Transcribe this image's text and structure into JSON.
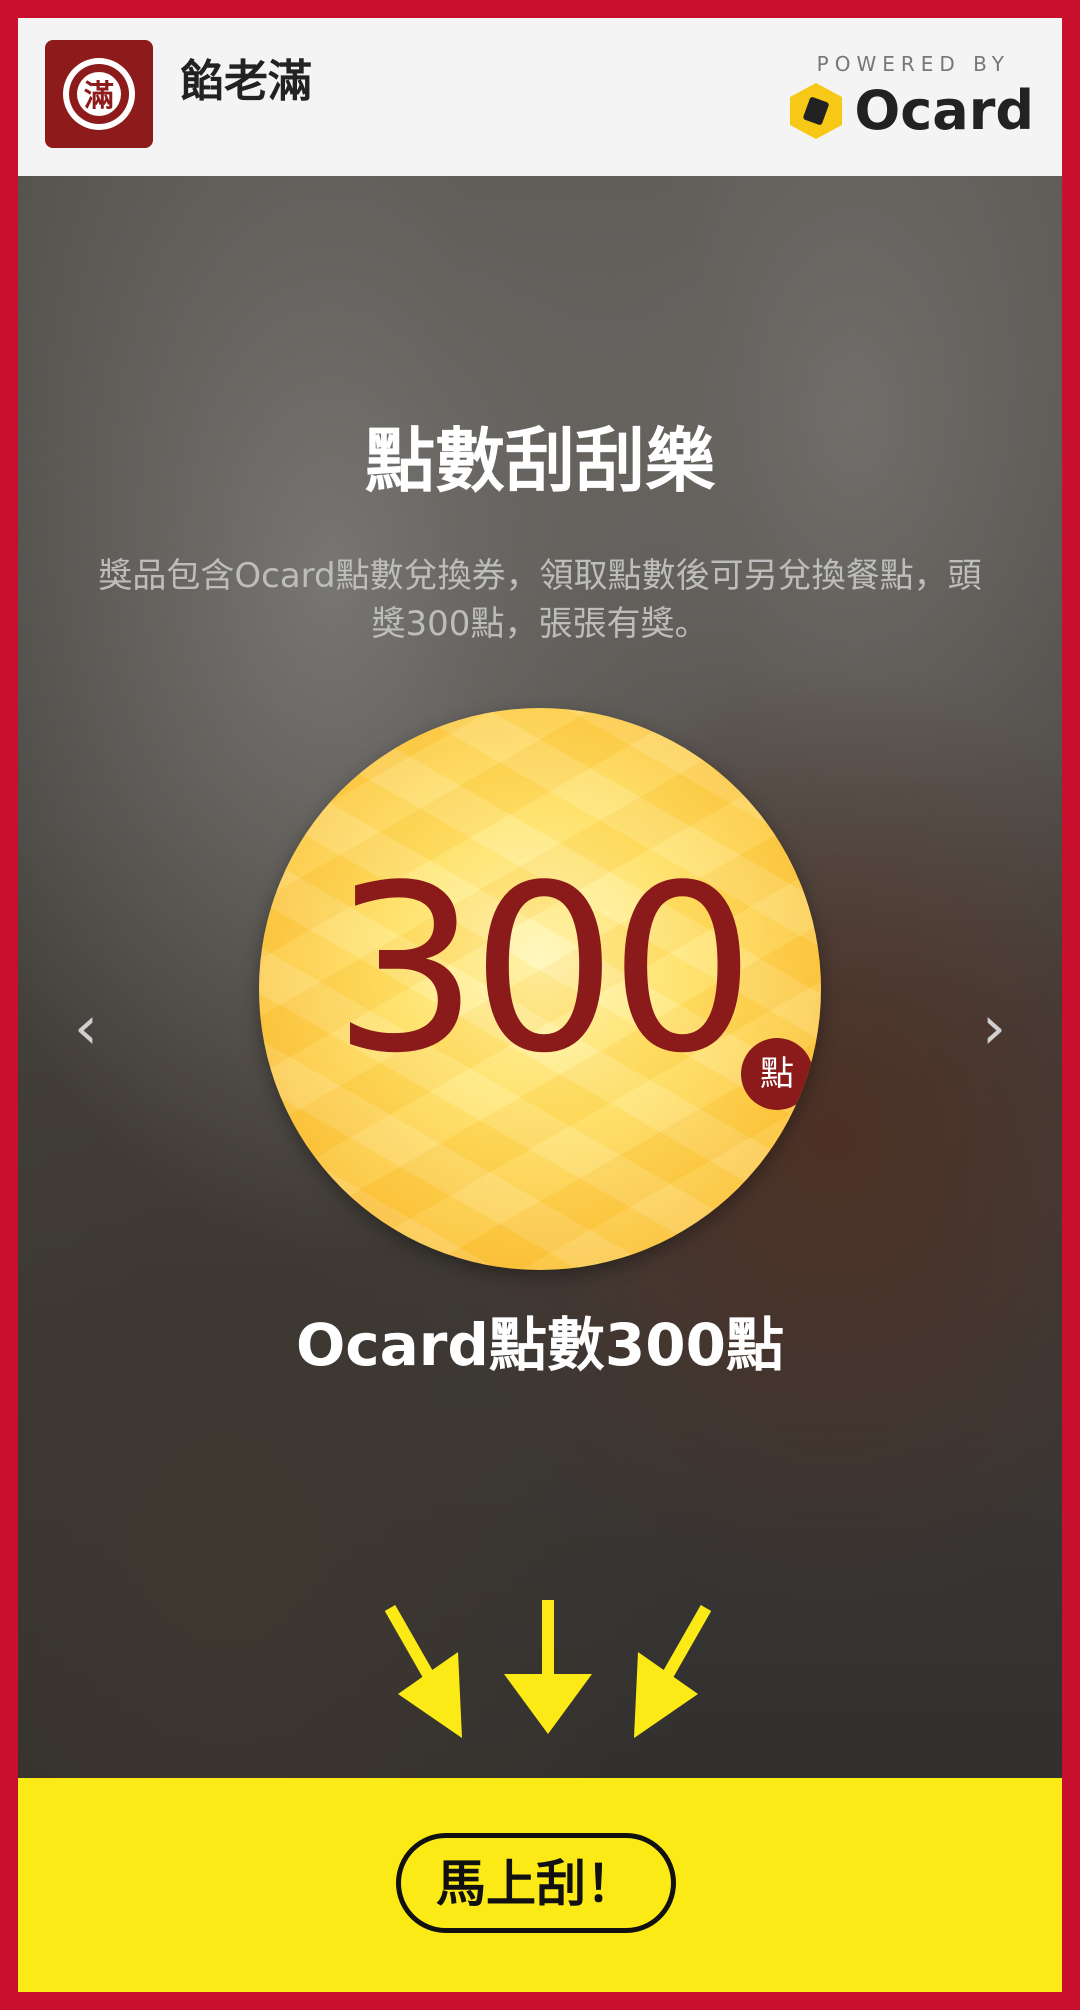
{
  "header": {
    "brand_name": "餡老滿",
    "logo_glyph": "滿",
    "powered_by": "POWERED BY",
    "ocard_logo_text": "Ocard"
  },
  "hero": {
    "title": "點數刮刮樂",
    "description": "獎品包含Ocard點數兌換券，領取點數後可另兌換餐點，頭獎300點，張張有獎。",
    "coin_value": "300",
    "coin_unit": "點",
    "prize_name": "Ocard點數300點",
    "prev_arrow": "‹",
    "next_arrow": "›"
  },
  "cta": {
    "scratch_label": "馬上刮！"
  },
  "colors": {
    "frame_red": "#c8102e",
    "brand_dark_red": "#8e1b1b",
    "accent_yellow": "#fcea16",
    "ocard_yellow": "#f7c815"
  },
  "icons": [
    "chevron-left-icon",
    "chevron-right-icon",
    "arrow-down-icon",
    "ocard-logo-icon"
  ]
}
